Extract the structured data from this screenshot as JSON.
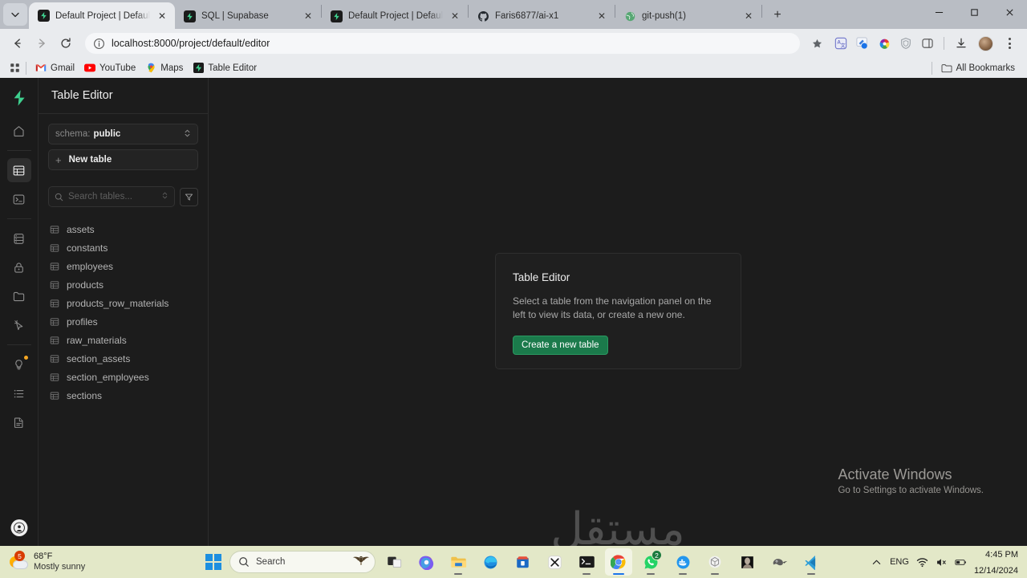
{
  "browser": {
    "tabs": [
      {
        "title": "Default Project | Default Organiz",
        "favicon": "supabase-icon",
        "active": true,
        "close_label": "✕"
      },
      {
        "title": "SQL | Supabase",
        "favicon": "supabase-icon",
        "active": false,
        "close_label": "✕"
      },
      {
        "title": "Default Project | Default Organ",
        "favicon": "supabase-icon",
        "active": false,
        "close_label": "✕"
      },
      {
        "title": "Faris6877/ai-x1",
        "favicon": "github-icon",
        "active": false,
        "close_label": "✕"
      },
      {
        "title": "git-push(1)",
        "favicon": "globe-icon",
        "active": false,
        "close_label": "✕"
      }
    ],
    "new_tab_label": "+",
    "tab_search_icon": "chevron-down-icon",
    "window_controls": {
      "minimize": "minimize-icon",
      "maximize": "restore-icon",
      "close": "close-icon"
    },
    "toolbar": {
      "back_icon": "back-arrow-icon",
      "forward_icon": "forward-arrow-icon",
      "reload_icon": "reload-icon",
      "site_info_icon": "info-circle-icon",
      "url_host": "localhost:8000",
      "url_path": "/project/default/editor",
      "url_full": "localhost:8000/project/default/editor",
      "star_icon": "bookmark-star-icon",
      "extensions": [
        "translate-icon",
        "paint-extension-icon",
        "color-wheel-icon",
        "shield-icon",
        "side-panel-icon"
      ],
      "download_icon": "download-icon",
      "profile_icon": "profile-avatar",
      "menu_icon": "kebab-menu-icon"
    },
    "bookmarks": {
      "apps_icon": "apps-grid-icon",
      "items": [
        {
          "label": "Gmail",
          "icon": "gmail-icon"
        },
        {
          "label": "YouTube",
          "icon": "youtube-icon"
        },
        {
          "label": "Maps",
          "icon": "maps-pin-icon"
        },
        {
          "label": "Table Editor",
          "icon": "supabase-icon"
        }
      ],
      "all_bookmarks_label": "All Bookmarks",
      "all_bookmarks_icon": "folder-icon"
    }
  },
  "app": {
    "rail": [
      {
        "name": "logo",
        "icon": "supabase-logo-icon",
        "active": false
      },
      {
        "name": "home",
        "icon": "home-icon",
        "active": false
      },
      {
        "name": "table-editor",
        "icon": "table-icon",
        "active": true
      },
      {
        "name": "sql-editor",
        "icon": "terminal-icon",
        "active": false
      },
      {
        "name": "database",
        "icon": "database-icon",
        "active": false
      },
      {
        "name": "authentication",
        "icon": "lock-icon",
        "active": false
      },
      {
        "name": "storage",
        "icon": "folder-icon",
        "active": false
      },
      {
        "name": "edge-functions",
        "icon": "cursor-zap-icon",
        "active": false
      },
      {
        "name": "advisors",
        "icon": "lightbulb-icon",
        "active": false,
        "badge": true
      },
      {
        "name": "logs",
        "icon": "list-icon",
        "active": false
      },
      {
        "name": "api-docs",
        "icon": "document-icon",
        "active": false
      }
    ],
    "rail_bottom_icon": "user-account-icon",
    "panel": {
      "title": "Table Editor",
      "schema_label": "schema:",
      "schema_value": "public",
      "schema_chevron_icon": "chevron-updown-icon",
      "new_table_label": "New table",
      "new_table_icon": "plus-icon",
      "search_placeholder": "Search tables...",
      "search_icon": "search-icon",
      "search_shortcut_icon": "chevron-updown-icon",
      "filter_icon": "filter-icon",
      "tables": [
        "assets",
        "constants",
        "employees",
        "products",
        "products_row_materials",
        "profiles",
        "raw_materials",
        "section_assets",
        "section_employees",
        "sections"
      ]
    },
    "empty_state": {
      "title": "Table Editor",
      "description": "Select a table from the navigation panel on the left to view its data, or create a new one.",
      "button_label": "Create a new table",
      "button_color": "#1b7a4b"
    }
  },
  "watermarks": {
    "activate_title": "Activate Windows",
    "activate_subtitle": "Go to Settings to activate Windows.",
    "mostaql": "مستقل"
  },
  "taskbar": {
    "weather": {
      "temperature": "68°F",
      "condition": "Mostly sunny",
      "badge": "5",
      "icon": "sun-cloud-icon"
    },
    "start_icon": "windows-start-icon",
    "search_placeholder": "Search",
    "search_icon": "search-icon",
    "search_decor_icon": "eagle-icon",
    "apps": [
      {
        "name": "task-view",
        "icon": "task-view-icon",
        "running": false,
        "focused": false
      },
      {
        "name": "copilot",
        "icon": "copilot-icon",
        "running": false,
        "focused": false
      },
      {
        "name": "file-explorer",
        "icon": "file-explorer-icon",
        "running": true,
        "focused": false
      },
      {
        "name": "microsoft-edge",
        "icon": "edge-icon",
        "running": false,
        "focused": false
      },
      {
        "name": "microsoft-store",
        "icon": "store-icon",
        "running": false,
        "focused": false
      },
      {
        "name": "capcut",
        "icon": "capcut-icon",
        "running": false,
        "focused": false
      },
      {
        "name": "terminal",
        "icon": "terminal-icon",
        "running": true,
        "focused": false
      },
      {
        "name": "google-chrome",
        "icon": "chrome-icon",
        "running": true,
        "focused": true
      },
      {
        "name": "whatsapp",
        "icon": "whatsapp-icon",
        "running": true,
        "focused": false,
        "badge": "2"
      },
      {
        "name": "docker",
        "icon": "docker-icon",
        "running": true,
        "focused": false
      },
      {
        "name": "chatgpt",
        "icon": "openai-icon",
        "running": true,
        "focused": false
      },
      {
        "name": "photo-app",
        "icon": "photo-icon",
        "running": false,
        "focused": false
      },
      {
        "name": "gimp",
        "icon": "gimp-icon",
        "running": false,
        "focused": false
      },
      {
        "name": "visual-studio-code",
        "icon": "vscode-icon",
        "running": true,
        "focused": false
      }
    ],
    "tray": {
      "overflow_icon": "chevron-up-icon",
      "language": "ENG",
      "wifi_icon": "wifi-icon",
      "volume_icon": "volume-muted-icon",
      "battery_icon": "battery-icon",
      "time": "4:45 PM",
      "date": "12/14/2024"
    }
  }
}
